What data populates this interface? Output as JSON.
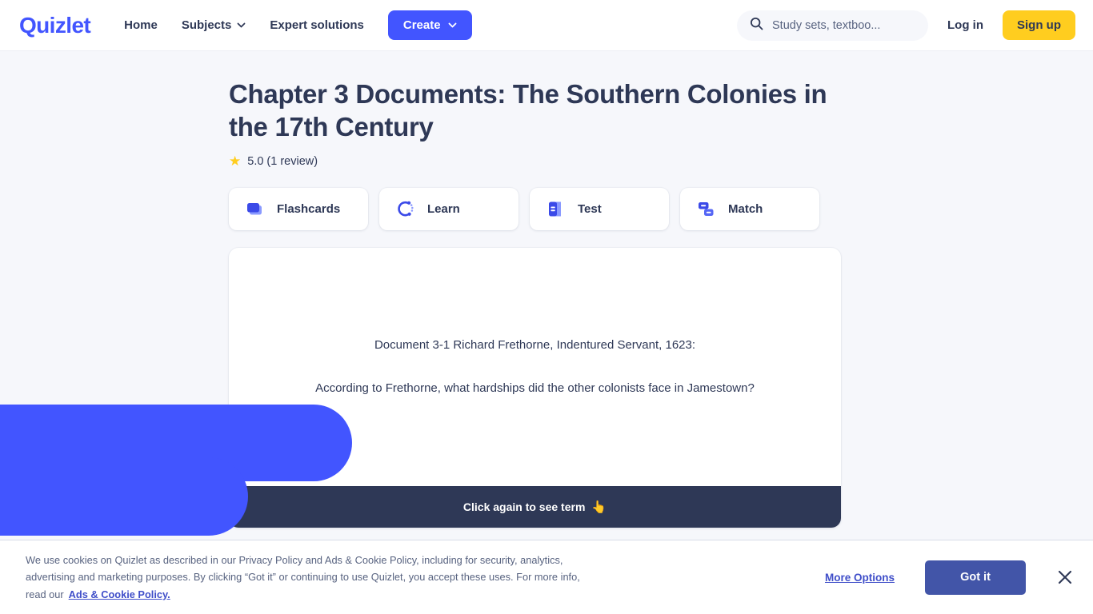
{
  "brand": {
    "logo_text": "Quizlet",
    "accent_blue": "#4255ff",
    "accent_yellow": "#ffcd1f",
    "dark": "#2e3856",
    "page_bg": "#f6f7fb"
  },
  "header": {
    "nav": [
      {
        "label": "Home",
        "has_chevron": false,
        "icon": ""
      },
      {
        "label": "Subjects",
        "has_chevron": true,
        "icon": "chevron-down-icon"
      },
      {
        "label": "Expert solutions",
        "has_chevron": false,
        "icon": ""
      }
    ],
    "create_label": "Create",
    "search": {
      "placeholder": "Study sets, textboo...",
      "value": "",
      "icon": "search-icon"
    },
    "login_label": "Log in",
    "signup_label": "Sign up"
  },
  "set": {
    "title": "Chapter 3 Documents: The Southern Colonies in the 17th Century",
    "rating_star": "★",
    "rating_text": "5.0 (1 review)"
  },
  "modes": [
    {
      "label": "Flashcards",
      "icon": "flashcards-icon"
    },
    {
      "label": "Learn",
      "icon": "learn-icon"
    },
    {
      "label": "Test",
      "icon": "test-icon"
    },
    {
      "label": "Match",
      "icon": "match-icon"
    }
  ],
  "flashcard": {
    "line1": "Document 3-1 Richard Frethorne, Indentured Servant, 1623:",
    "line2": "According to Frethorne, what hardships did the other colonists face in Jamestown?",
    "footer_text": "Click again to see term",
    "footer_emoji": "👆"
  },
  "cookie_banner": {
    "text": "We use cookies on Quizlet as described in our Privacy Policy and Ads & Cookie Policy, including for security, analytics, advertising and marketing purposes. By clicking “Got it” or continuing to use Quizlet, you accept these uses. For more info, read our",
    "link_label": "Ads & Cookie Policy.",
    "more_options_label": "More Options",
    "got_it_label": "Got it",
    "close_icon": "close-icon"
  }
}
